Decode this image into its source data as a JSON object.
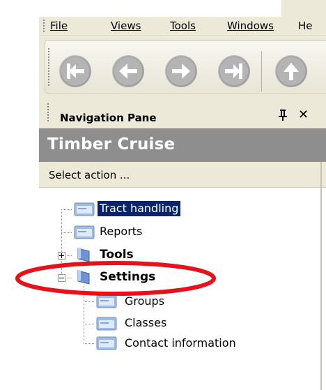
{
  "menu": {
    "items": [
      {
        "label": "File"
      },
      {
        "label": "Views"
      },
      {
        "label": "Tools"
      },
      {
        "label": "Windows"
      },
      {
        "label": "He"
      }
    ]
  },
  "toolbar": {
    "buttons": [
      {
        "icon": "first-record-icon"
      },
      {
        "icon": "previous-record-icon"
      },
      {
        "icon": "next-record-icon"
      },
      {
        "icon": "last-record-icon"
      },
      {
        "icon": "up-icon"
      }
    ]
  },
  "navigation_pane": {
    "title": "Navigation Pane",
    "pin_icon": "pin-icon",
    "close_icon": "close-icon",
    "app_title": "Timber Cruise",
    "action_label": "Select action ...",
    "tree": [
      {
        "label": "Tract handling",
        "selected": true,
        "icon": "form-icon"
      },
      {
        "label": "Reports",
        "icon": "form-icon"
      },
      {
        "label": "Tools",
        "bold": true,
        "expander": "plus",
        "icon": "folder-icon"
      },
      {
        "label": "Settings",
        "bold": true,
        "expander": "minus",
        "icon": "folder-icon",
        "children": [
          {
            "label": "Groups",
            "icon": "form-icon"
          },
          {
            "label": "Classes",
            "icon": "form-icon"
          },
          {
            "label": "Contact information",
            "icon": "form-icon"
          }
        ]
      }
    ]
  },
  "annotation": {
    "color": "#e8101a",
    "shape": "ellipse"
  },
  "colors": {
    "chrome": "#ece9d8",
    "band": "#8e8e8e",
    "selection": "#0a246a"
  }
}
